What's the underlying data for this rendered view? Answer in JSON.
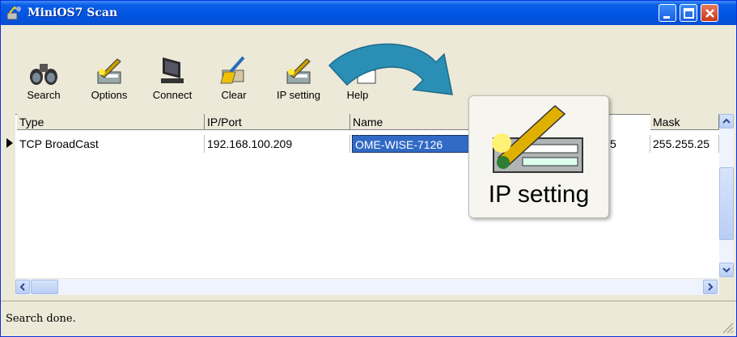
{
  "window": {
    "title": "MiniOS7 Scan"
  },
  "toolbar": {
    "search": "Search",
    "options": "Options",
    "connect": "Connect",
    "clear": "Clear",
    "ip_setting": "IP setting",
    "help": "Help"
  },
  "grid": {
    "columns": [
      "Type",
      "IP/Port",
      "Name",
      "Mask"
    ],
    "rows": [
      {
        "type": "TCP BroadCast",
        "ip_port": "192.168.100.209",
        "name": "OME-WISE-7126",
        "partial": "5",
        "mask": "255.255.25"
      }
    ]
  },
  "popup": {
    "label": "IP setting"
  },
  "status": {
    "text": "Search done."
  },
  "colors": {
    "titlebar": "#0054e3",
    "selection": "#316ac5",
    "arrow": "#2b8fb5"
  }
}
